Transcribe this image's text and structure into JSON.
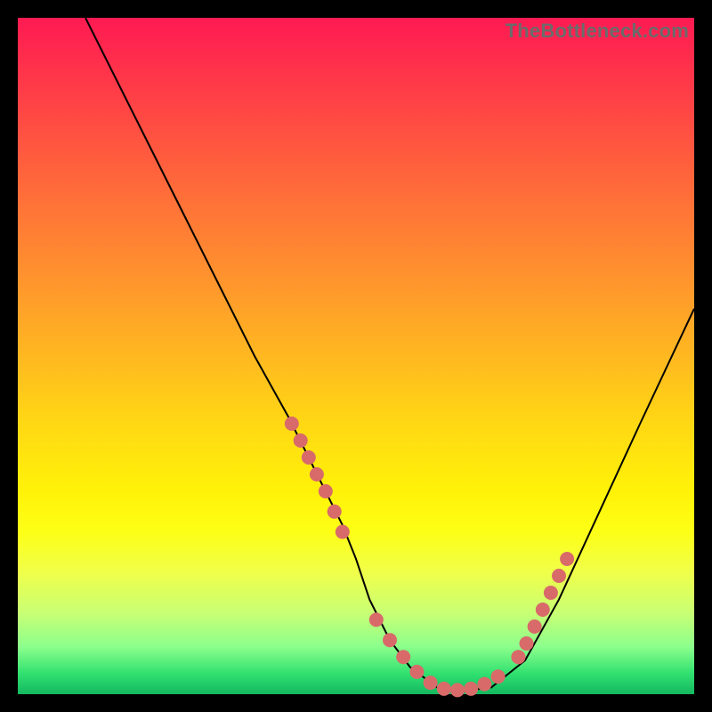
{
  "watermark": "TheBottleneck.com",
  "chart_data": {
    "type": "line",
    "title": "",
    "xlabel": "",
    "ylabel": "",
    "xlim": [
      0,
      100
    ],
    "ylim": [
      0,
      100
    ],
    "grid": false,
    "legend": false,
    "background": "vertical gradient red→orange→yellow→green",
    "series": [
      {
        "name": "bottleneck-curve",
        "x": [
          10,
          15,
          20,
          25,
          30,
          35,
          40,
          45,
          48,
          50,
          52,
          55,
          58,
          62,
          66,
          70,
          75,
          80,
          86,
          92,
          100
        ],
        "y": [
          100,
          90,
          80,
          70,
          60,
          50,
          41,
          31,
          25,
          20,
          14,
          8,
          4,
          1,
          0.5,
          1,
          5,
          14,
          27,
          40,
          57
        ]
      }
    ],
    "markers": [
      {
        "name": "highlight-dots-left",
        "x": [
          40.5,
          41.8,
          43.0,
          44.2,
          45.5,
          46.8,
          48.0
        ],
        "y": [
          40.0,
          37.5,
          35.0,
          32.5,
          30.0,
          27.0,
          24.0
        ]
      },
      {
        "name": "highlight-dots-bottom",
        "x": [
          53,
          55,
          57,
          59,
          61,
          63,
          65,
          67,
          69,
          71
        ],
        "y": [
          11,
          8,
          5.5,
          3.3,
          1.7,
          0.8,
          0.6,
          0.8,
          1.5,
          2.6
        ]
      },
      {
        "name": "highlight-dots-right",
        "x": [
          74.0,
          75.2,
          76.4,
          77.6,
          78.8,
          80.0,
          81.2
        ],
        "y": [
          5.5,
          7.5,
          10.0,
          12.5,
          15.0,
          17.5,
          20.0
        ]
      }
    ]
  }
}
